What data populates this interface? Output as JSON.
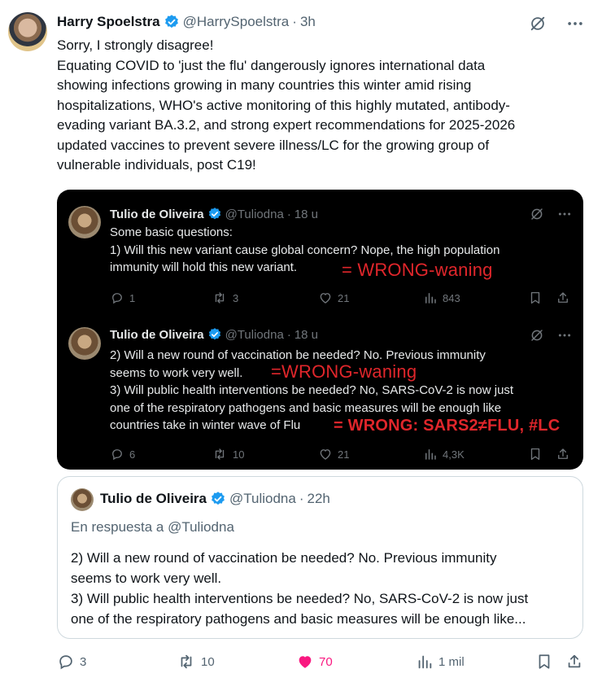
{
  "tweet": {
    "author_name": "Harry Spoelstra",
    "handle": "@HarrySpoelstra",
    "separator": "·",
    "time": "3h",
    "lines": [
      "Sorry, I strongly disagree!",
      "Equating COVID to 'just the flu' dangerously ignores international data",
      "showing infections growing in many countries this winter amid rising",
      "hospitalizations, WHO's active monitoring of this highly mutated, antibody-",
      "evading variant BA.3.2, and strong expert recommendations for 2025-2026",
      "updated vaccines to prevent severe illness/LC for the growing group of",
      "vulnerable individuals, post C19!"
    ]
  },
  "media": {
    "tweet1": {
      "author_name": "Tulio de Oliveira",
      "handle": "@Tuliodna",
      "separator": "·",
      "time": "18 u",
      "lines": [
        "Some basic questions:",
        "1) Will this new variant cause global concern? Nope, the high population",
        "immunity will hold this new variant."
      ],
      "annotation": "= WRONG-waning",
      "replies": "1",
      "reposts": "3",
      "likes": "21",
      "views": "843"
    },
    "tweet2": {
      "author_name": "Tulio de Oliveira",
      "handle": "@Tuliodna",
      "separator": "·",
      "time": "18 u",
      "lines": [
        "2) Will a new round of vaccination be needed? No. Previous immunity",
        "seems to work very well.",
        "3) Will public health interventions be needed? No, SARS-CoV-2 is now just",
        "one of the respiratory pathogens and basic measures will be enough like",
        "countries take in winter wave of Flu"
      ],
      "annotation1": "=WRONG-waning",
      "annotation2": "= WRONG: SARS2≠FLU, #LC",
      "replies": "6",
      "reposts": "10",
      "likes": "21",
      "views": "4,3K"
    }
  },
  "quote": {
    "author_name": "Tulio de Oliveira",
    "handle": "@Tuliodna",
    "separator": "·",
    "time": "22h",
    "reply_to": "En respuesta a @Tuliodna",
    "lines": [
      "2) Will a new round of vaccination be needed? No. Previous immunity",
      "seems to work very well.",
      "3) Will public health interventions be needed? No, SARS-CoV-2 is now just",
      "one of the respiratory pathogens and basic measures will be enough like..."
    ]
  },
  "actions": {
    "replies": "3",
    "reposts": "10",
    "likes": "70",
    "views": "1 mil"
  },
  "colors": {
    "verified": "#1d9bf0",
    "like_active": "#f91880",
    "annotation": "#e0262b",
    "muted": "#536471"
  }
}
